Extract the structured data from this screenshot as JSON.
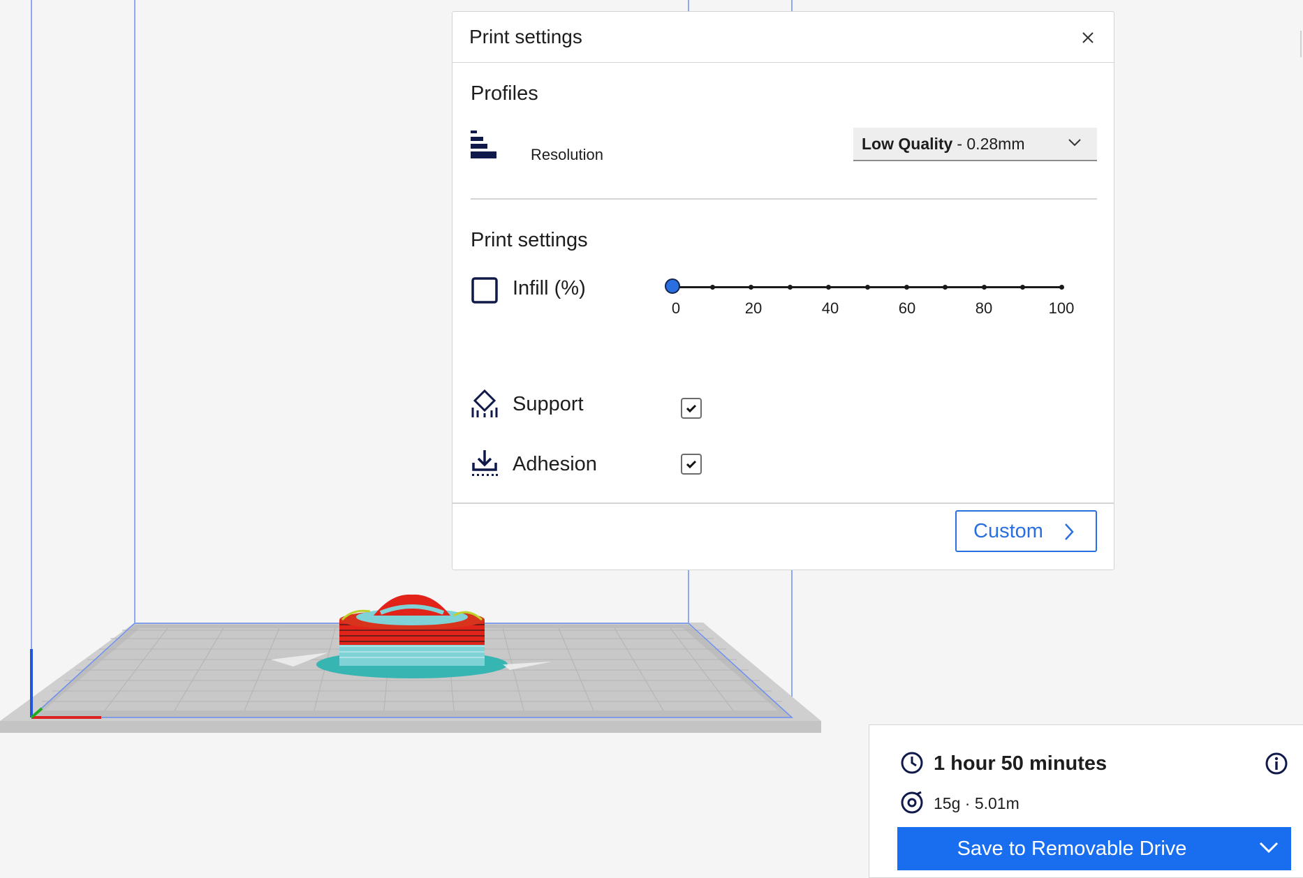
{
  "print_settings_panel": {
    "title": "Print settings",
    "close_icon": "close-icon",
    "profiles": {
      "heading": "Profiles",
      "resolution_label": "Resolution",
      "resolution_icon": "resolution-bars-icon",
      "selected_quality": "Low Quality",
      "selected_layer_height": " - 0.28mm"
    },
    "settings": {
      "heading": "Print settings",
      "infill": {
        "label": "Infill (%)",
        "icon": "infill-square-icon",
        "value": 0,
        "ticks": [
          "0",
          "20",
          "40",
          "60",
          "80",
          "100"
        ]
      },
      "support": {
        "label": "Support",
        "icon": "support-icon",
        "checked": true
      },
      "adhesion": {
        "label": "Adhesion",
        "icon": "adhesion-icon",
        "checked": true
      }
    },
    "custom_button_label": "Custom"
  },
  "print_info": {
    "time": "1 hour 50 minutes",
    "material": "15g · 5.01m",
    "save_button_label": "Save to Removable Drive"
  },
  "colors": {
    "accent": "#196ef0",
    "model_red": "#e2231a",
    "model_cyan": "#38b6b6",
    "bed_gray": "#c8c8c8"
  }
}
